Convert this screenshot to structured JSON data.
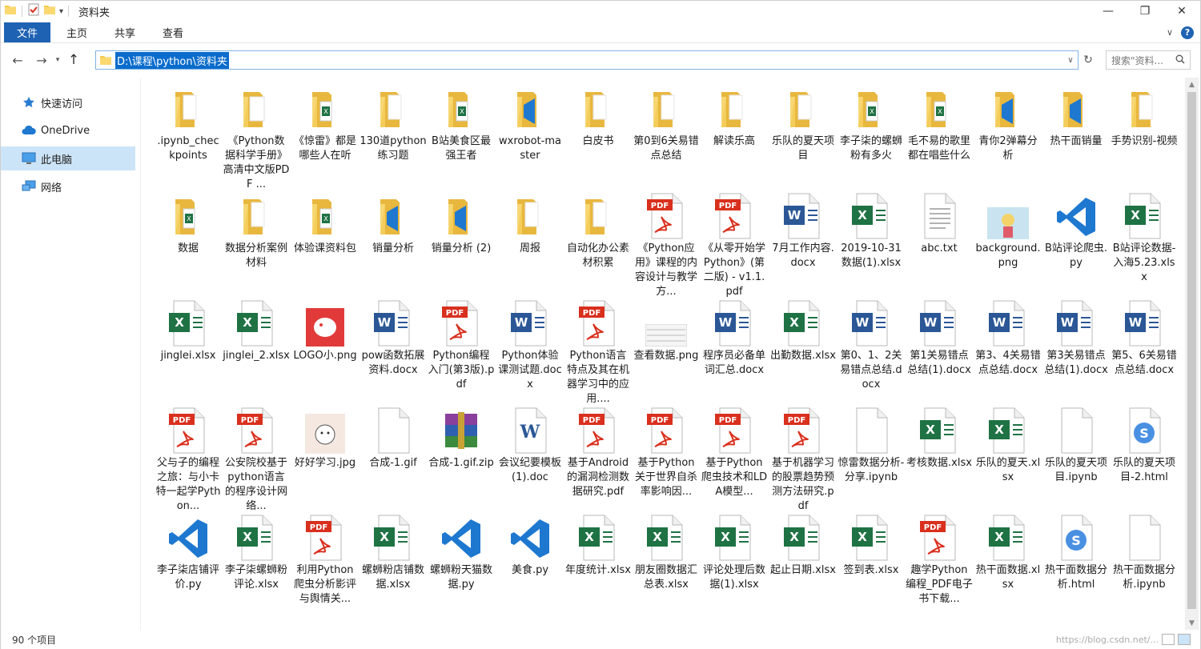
{
  "window": {
    "title": "资料夹"
  },
  "ribbon": {
    "tabs": [
      "文件",
      "主页",
      "共享",
      "查看"
    ]
  },
  "address": {
    "path": "D:\\课程\\python\\资料夹",
    "search_placeholder": "搜索\"资料..."
  },
  "sidebar": {
    "items": [
      "快速访问",
      "OneDrive",
      "此电脑",
      "网络"
    ],
    "selected": 2
  },
  "status": {
    "count": "90 个项目",
    "watermark": "https://blog.csdn.net/..."
  },
  "colors": {
    "accent": "#1e62b3",
    "excel": "#1f7244",
    "word": "#2b5796",
    "pdf": "#d9301e",
    "vscode": "#1e78d0",
    "folder": "#f7d774"
  },
  "files": [
    {
      "name": ".ipynb_checkpoints",
      "type": "folder"
    },
    {
      "name": "《Python数据科学手册》高清中文版PDF ...",
      "type": "folder-doc"
    },
    {
      "name": "《惊雷》都是哪些人在听",
      "type": "folder-excel"
    },
    {
      "name": "130道python练习题",
      "type": "folder"
    },
    {
      "name": "B站美食区最强王者",
      "type": "folder-excel"
    },
    {
      "name": "wxrobot-master",
      "type": "folder-vscode"
    },
    {
      "name": "白皮书",
      "type": "folder"
    },
    {
      "name": "第0到6关易错点总结",
      "type": "folder"
    },
    {
      "name": "解读乐高",
      "type": "folder"
    },
    {
      "name": "乐队的夏天项目",
      "type": "folder"
    },
    {
      "name": "李子柒的螺蛳粉有多火",
      "type": "folder-excel"
    },
    {
      "name": "毛不易的歌里都在唱些什么",
      "type": "folder-excel"
    },
    {
      "name": "青你2弹幕分析",
      "type": "folder-vscode"
    },
    {
      "name": "热干面销量",
      "type": "folder-vscode"
    },
    {
      "name": "手势识别-视频",
      "type": "folder"
    },
    {
      "name": "数据",
      "type": "folder-excel"
    },
    {
      "name": "数据分析案例材料",
      "type": "folder"
    },
    {
      "name": "体验课资料包",
      "type": "folder-excel"
    },
    {
      "name": "销量分析",
      "type": "folder-vscode"
    },
    {
      "name": "销量分析 (2)",
      "type": "folder-vscode"
    },
    {
      "name": "周报",
      "type": "folder"
    },
    {
      "name": "自动化办公素材积累",
      "type": "folder"
    },
    {
      "name": "《Python应用》课程的内容设计与教学方...",
      "type": "pdf"
    },
    {
      "name": "《从零开始学 Python》(第二版) - v1.1.pdf",
      "type": "pdf"
    },
    {
      "name": "7月工作内容.docx",
      "type": "word"
    },
    {
      "name": "2019-10-31数据(1).xlsx",
      "type": "excel"
    },
    {
      "name": "abc.txt",
      "type": "txt"
    },
    {
      "name": "background.png",
      "type": "image-anime"
    },
    {
      "name": "B站评论爬虫.py",
      "type": "vscode"
    },
    {
      "name": "B站评论数据-入海5.23.xlsx",
      "type": "excel"
    },
    {
      "name": "jinglei.xlsx",
      "type": "excel"
    },
    {
      "name": "jinglei_2.xlsx",
      "type": "excel"
    },
    {
      "name": "LOGO小.png",
      "type": "image-elephant"
    },
    {
      "name": "pow函数拓展资料.docx",
      "type": "word"
    },
    {
      "name": "Python编程入门(第3版).pdf",
      "type": "pdf"
    },
    {
      "name": "Python体验课测试题.docx",
      "type": "word"
    },
    {
      "name": "Python语言特点及其在机器学习中的应用....",
      "type": "pdf"
    },
    {
      "name": "查看数据.png",
      "type": "image-table"
    },
    {
      "name": "程序员必备单词汇总.docx",
      "type": "word"
    },
    {
      "name": "出勤数据.xlsx",
      "type": "excel"
    },
    {
      "name": "第0、1、2关易错点总结.docx",
      "type": "word"
    },
    {
      "name": "第1关易错点总结(1).docx",
      "type": "word"
    },
    {
      "name": "第3、4关易错点总结.docx",
      "type": "word"
    },
    {
      "name": "第3关易错点总结(1).docx",
      "type": "word"
    },
    {
      "name": "第5、6关易错点总结.docx",
      "type": "word"
    },
    {
      "name": "父与子的编程之旅：与小卡特一起学Python...",
      "type": "pdf"
    },
    {
      "name": "公安院校基于python语言的程序设计网络...",
      "type": "pdf"
    },
    {
      "name": "好好学习.jpg",
      "type": "image-cartoon"
    },
    {
      "name": "合成-1.gif",
      "type": "blank"
    },
    {
      "name": "合成-1.gif.zip",
      "type": "zip"
    },
    {
      "name": "会议纪要模板(1).doc",
      "type": "word-old"
    },
    {
      "name": "基于Android的漏洞检测数据研究.pdf",
      "type": "pdf"
    },
    {
      "name": "基于Python关于世界自杀率影响因...",
      "type": "pdf"
    },
    {
      "name": "基于Python爬虫技术和LDA模型...",
      "type": "pdf"
    },
    {
      "name": "基于机器学习的股票趋势预测方法研究.pdf",
      "type": "pdf"
    },
    {
      "name": "惊雷数据分析-分享.ipynb",
      "type": "blank"
    },
    {
      "name": "考核数据.xlsx",
      "type": "excel"
    },
    {
      "name": "乐队的夏天.xlsx",
      "type": "excel"
    },
    {
      "name": "乐队的夏天项目.ipynb",
      "type": "blank"
    },
    {
      "name": "乐队的夏天项目-2.html",
      "type": "sogou"
    },
    {
      "name": "李子柒店铺评价.py",
      "type": "vscode"
    },
    {
      "name": "李子柒螺蛳粉评论.xlsx",
      "type": "excel"
    },
    {
      "name": "利用Python爬虫分析影评与舆情关...",
      "type": "pdf"
    },
    {
      "name": "螺蛳粉店铺数据.xlsx",
      "type": "excel"
    },
    {
      "name": "螺蛳粉天猫数据.py",
      "type": "vscode"
    },
    {
      "name": "美食.py",
      "type": "vscode"
    },
    {
      "name": "年度统计.xlsx",
      "type": "excel"
    },
    {
      "name": "朋友圈数据汇总表.xlsx",
      "type": "excel"
    },
    {
      "name": "评论处理后数据(1).xlsx",
      "type": "excel"
    },
    {
      "name": "起止日期.xlsx",
      "type": "excel"
    },
    {
      "name": "签到表.xlsx",
      "type": "excel"
    },
    {
      "name": "趣学Python编程_PDF电子书下载...",
      "type": "pdf"
    },
    {
      "name": "热干面数据.xlsx",
      "type": "excel"
    },
    {
      "name": "热干面数据分析.html",
      "type": "sogou"
    },
    {
      "name": "热干面数据分析.ipynb",
      "type": "blank"
    }
  ]
}
